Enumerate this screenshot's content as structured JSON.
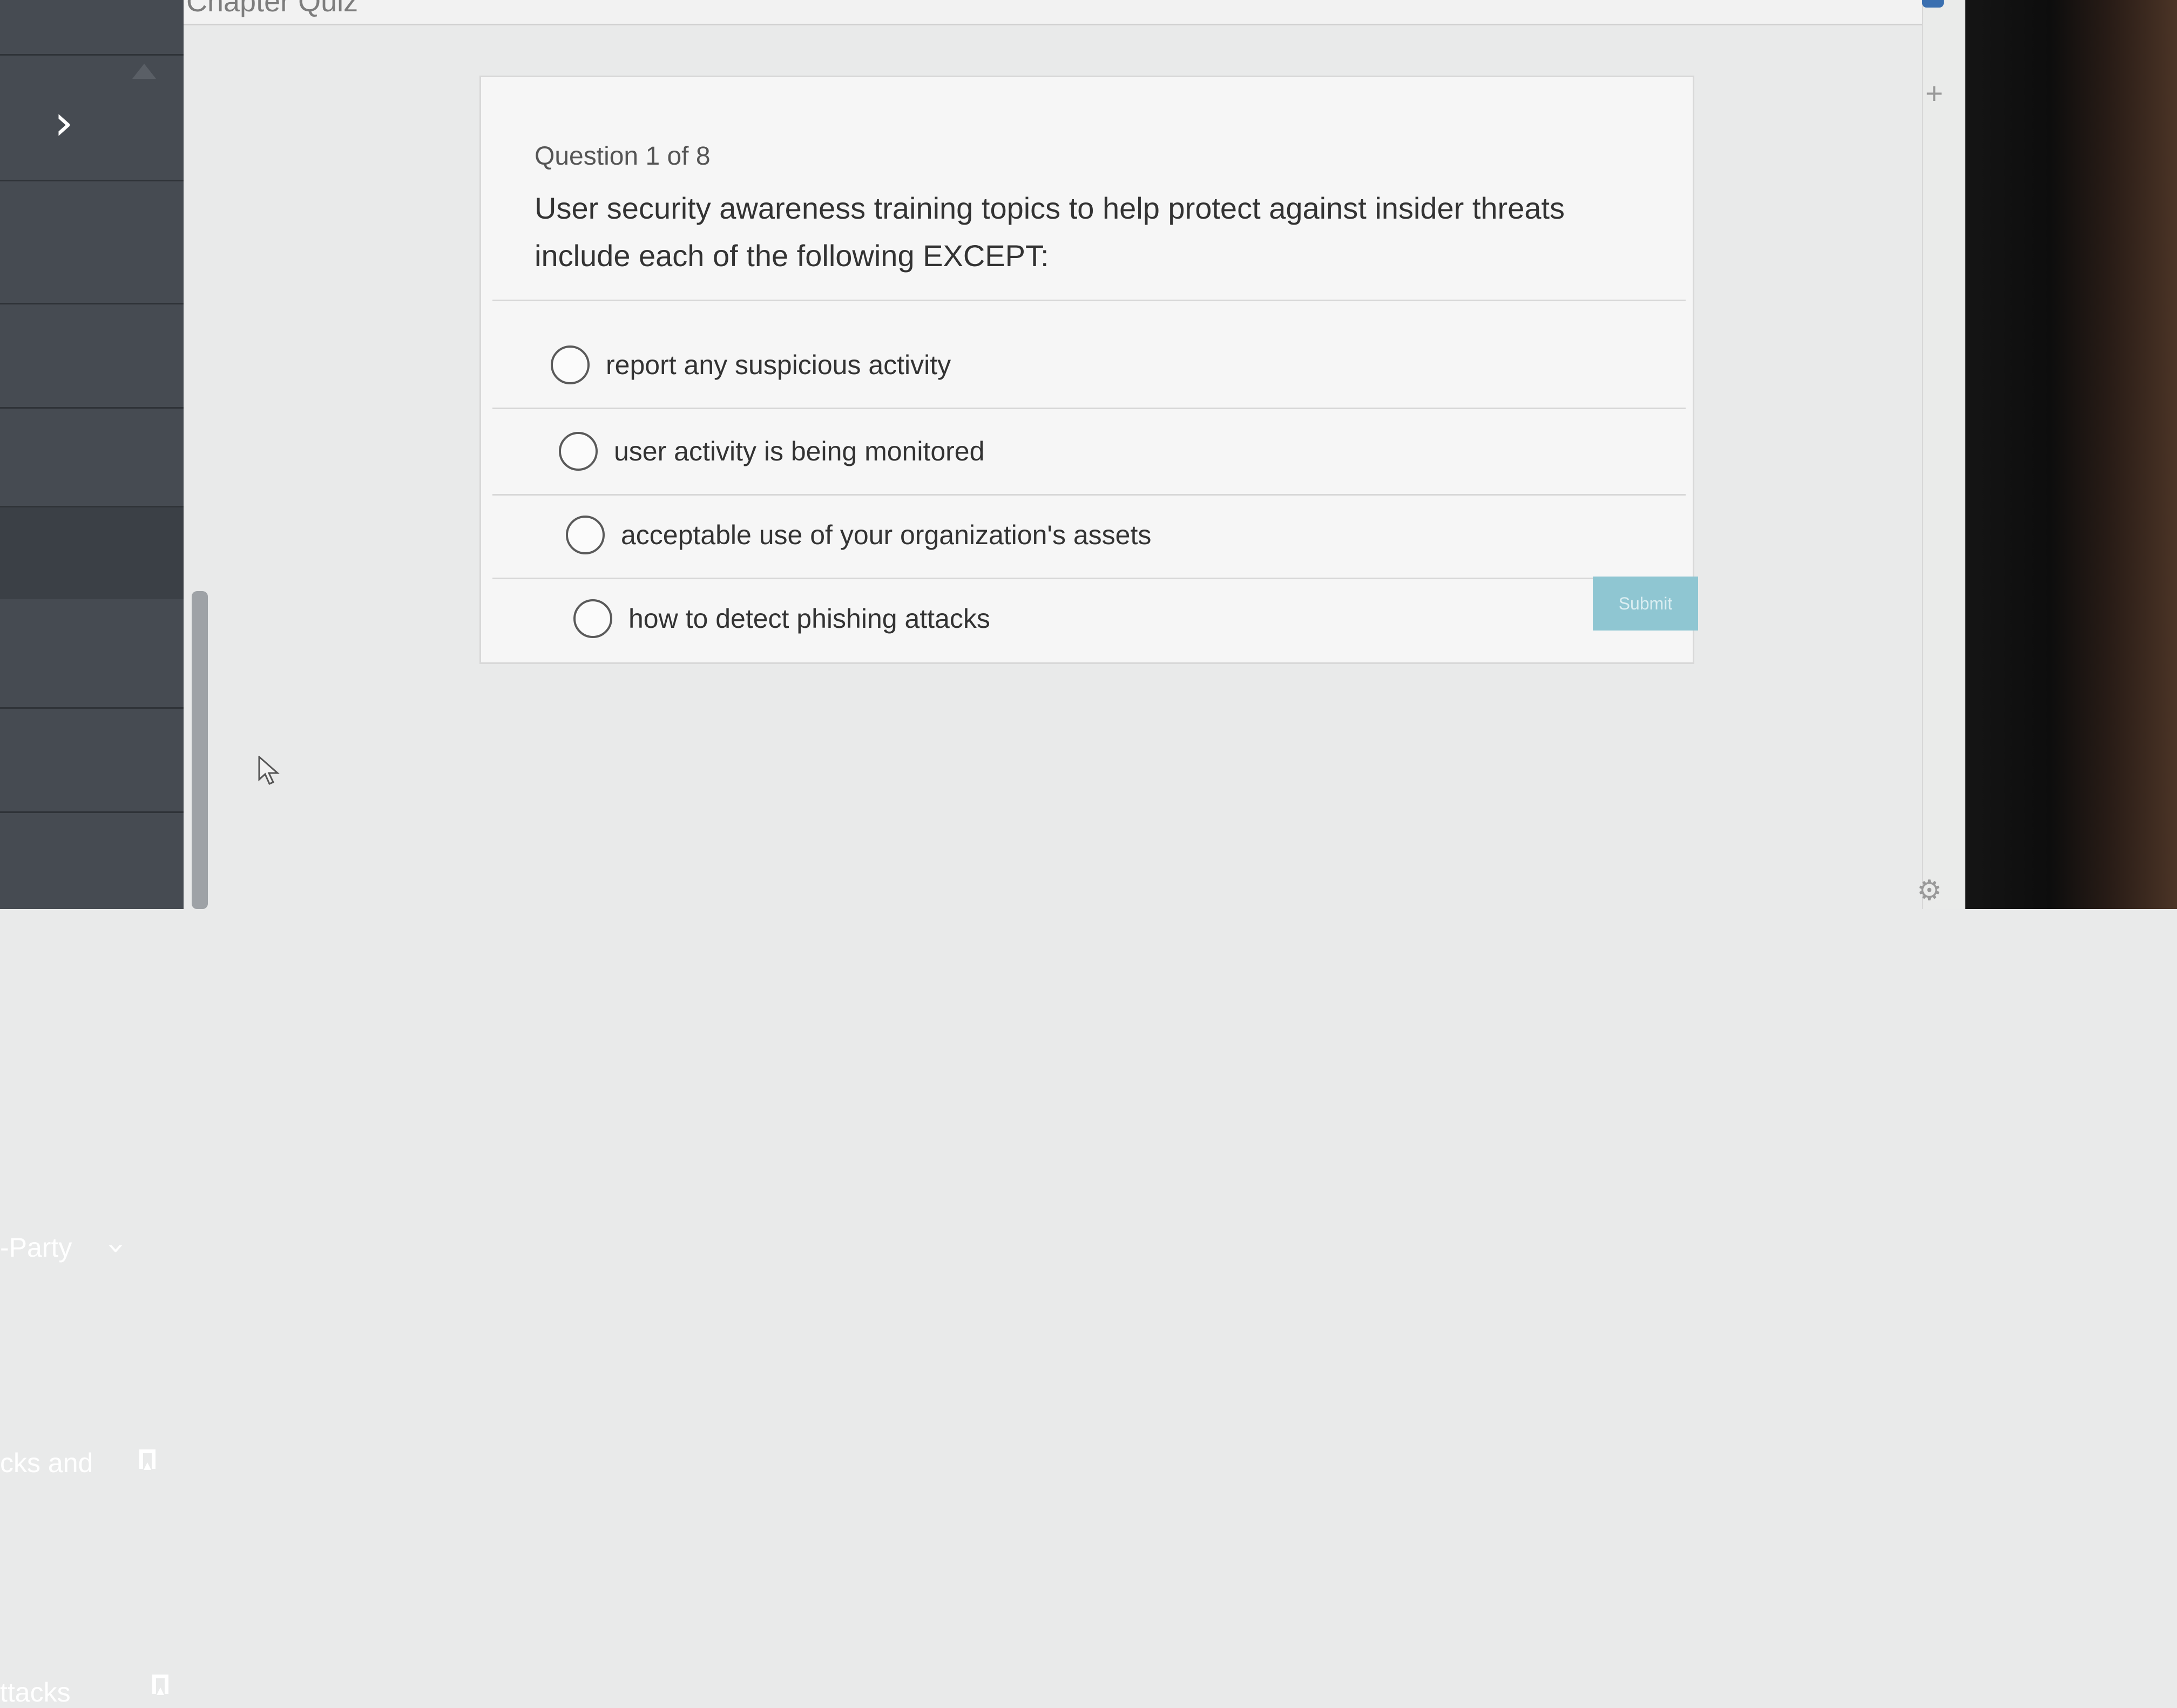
{
  "header": {
    "chapter_title": "Chapter Quiz"
  },
  "sidebar": {
    "icons": {
      "forward": "chevron-right-icon",
      "expand": "chevron-down-icon",
      "bookmark": "bookmark-icon"
    },
    "items": [
      {
        "label": "-Party"
      },
      {
        "label": "cks and"
      },
      {
        "label": "ttacks"
      }
    ]
  },
  "quiz": {
    "counter": "Question 1 of 8",
    "question": "User security awareness training topics to help protect against insider threats include each of the following EXCEPT:",
    "options": [
      {
        "label": "report any suspicious activity",
        "selected": false
      },
      {
        "label": "user activity is being monitored",
        "selected": false
      },
      {
        "label": "acceptable use of your organization's assets",
        "selected": false
      },
      {
        "label": "how to detect phishing attacks",
        "selected": false
      }
    ],
    "submit_label": "Submit"
  },
  "right_rail": {
    "plus": "+",
    "gear": "⚙"
  },
  "colors": {
    "sidebar_bg": "#3b4046",
    "submit_bg": "#8fc6d2",
    "page_bg": "#e9eaea"
  }
}
